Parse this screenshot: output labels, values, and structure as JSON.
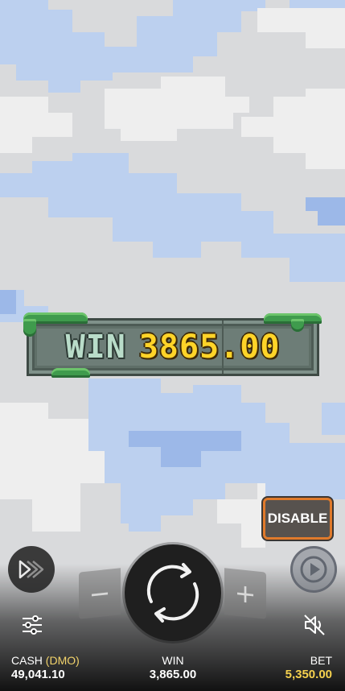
{
  "banner": {
    "label": "WIN",
    "value": "3865.00"
  },
  "controls": {
    "disable_label": "DISABLE",
    "minus_label": "−",
    "plus_label": "+"
  },
  "icons": {
    "turbo": "fast-forward-icon",
    "spin": "spin-arrows-icon",
    "autoplay": "autoplay-icon",
    "settings": "sliders-icon",
    "sound": "muted-speaker-icon"
  },
  "stats": {
    "cash_label": "CASH",
    "cash_mode": "(DMO)",
    "cash_value": "49,041.10",
    "win_label": "WIN",
    "win_value": "3,865.00",
    "bet_label": "BET",
    "bet_value": "5,350.00"
  },
  "colors": {
    "sky": "#bcd0ef",
    "cloud": "#e3e3e3",
    "win_amount": "#ffd428",
    "disable_border": "#e07a2b",
    "bet_value": "#f5d14e"
  }
}
